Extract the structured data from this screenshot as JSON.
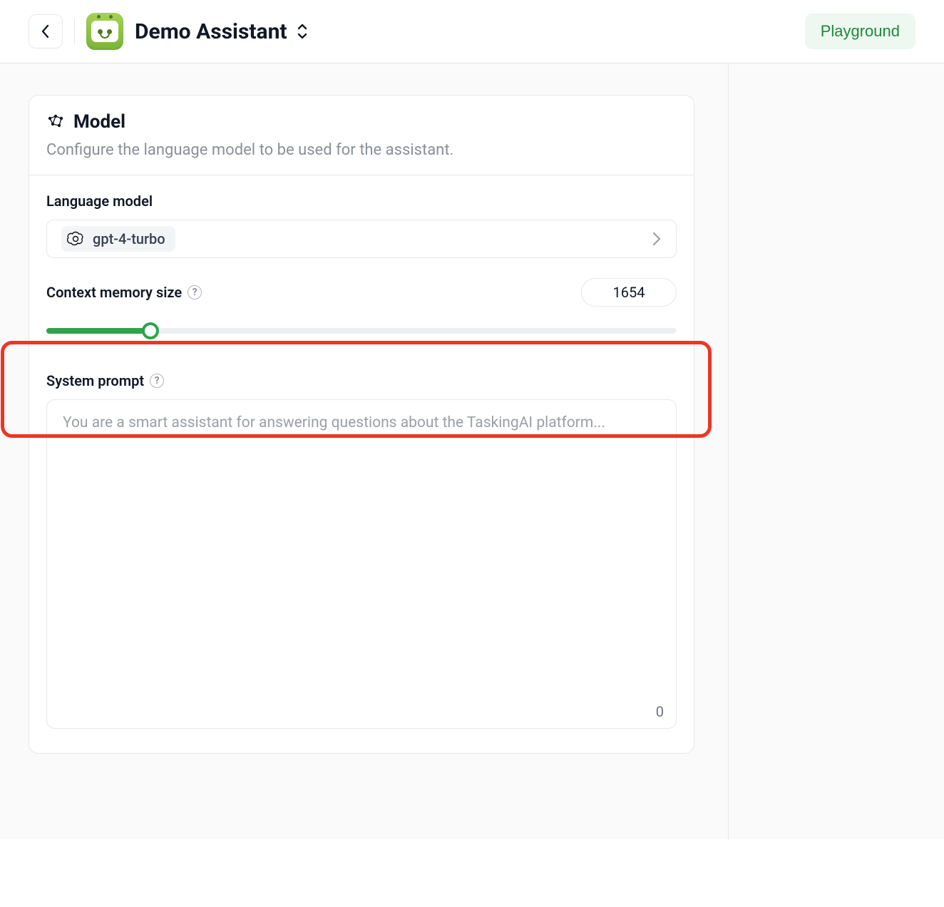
{
  "header": {
    "assistant_name": "Demo Assistant",
    "playground_button": "Playground"
  },
  "model_card": {
    "title": "Model",
    "subtitle": "Configure the language model to be used for the assistant.",
    "language_model_label": "Language model",
    "selected_model": "gpt-4-turbo",
    "context_memory_label": "Context memory size",
    "context_memory_value": "1654",
    "slider_fill_percent": 16.5,
    "system_prompt_label": "System prompt",
    "system_prompt_placeholder": "You are a smart assistant for answering questions about the TaskingAI platform...",
    "system_prompt_value": "",
    "char_count": "0"
  },
  "colors": {
    "accent_green": "#2fa34c",
    "highlight_red": "#ee3524"
  }
}
